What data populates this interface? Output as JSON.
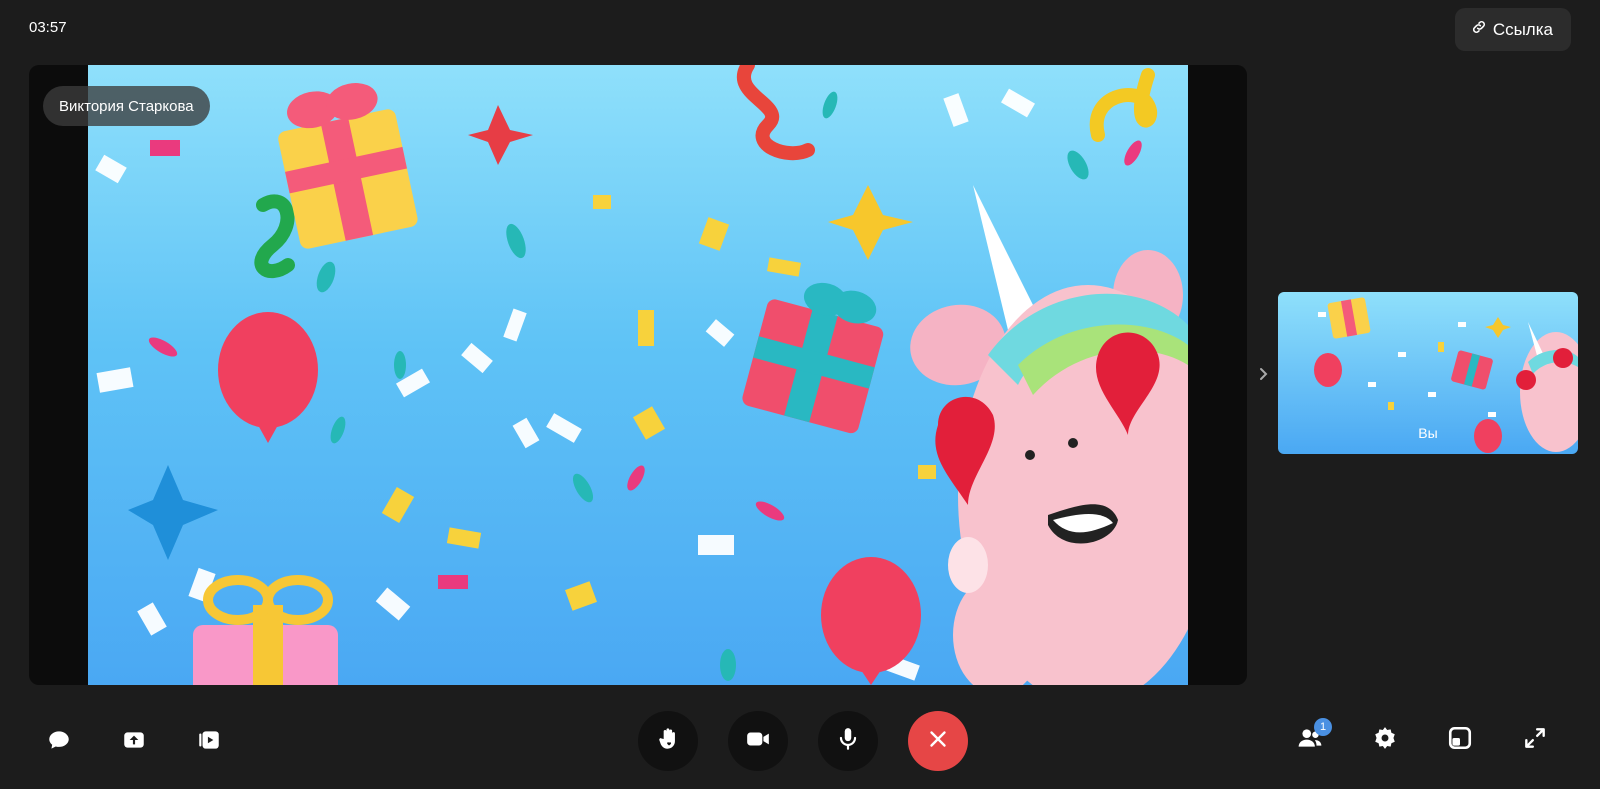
{
  "header": {
    "timer": "03:57",
    "link_button_label": "Ссылка"
  },
  "main_video": {
    "participant_name": "Виктория Старкова"
  },
  "self_view": {
    "label": "Вы"
  },
  "toolbar": {
    "left": [
      {
        "name": "chat-icon"
      },
      {
        "name": "screen-share-icon"
      },
      {
        "name": "media-playback-icon"
      }
    ],
    "center": [
      {
        "name": "raise-hand-icon"
      },
      {
        "name": "camera-icon"
      },
      {
        "name": "microphone-icon"
      },
      {
        "name": "end-call-icon"
      }
    ],
    "right": [
      {
        "name": "participants-icon",
        "badge": "1"
      },
      {
        "name": "settings-icon"
      },
      {
        "name": "layout-icon"
      },
      {
        "name": "fullscreen-icon"
      }
    ]
  },
  "colors": {
    "background": "#1c1c1c",
    "end_call": "#e64646",
    "badge": "#4a90e2"
  }
}
